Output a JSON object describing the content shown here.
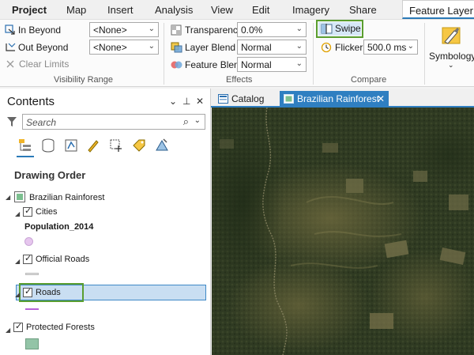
{
  "ribbon_tabs": [
    "Project",
    "Map",
    "Insert",
    "Analysis",
    "View",
    "Edit",
    "Imagery",
    "Share",
    "Feature Layer"
  ],
  "visibility_range": {
    "in_beyond_label": "In Beyond",
    "in_beyond_value": "<None>",
    "out_beyond_label": "Out Beyond",
    "out_beyond_value": "<None>",
    "clear_limits_label": "Clear Limits",
    "group_label": "Visibility Range"
  },
  "effects": {
    "transparency_label": "Transparency",
    "transparency_value": "0.0%",
    "layer_blend_label": "Layer Blend",
    "layer_blend_value": "Normal",
    "feature_blend_label": "Feature Blend",
    "feature_blend_value": "Normal",
    "group_label": "Effects"
  },
  "compare": {
    "swipe_label": "Swipe",
    "flicker_label": "Flicker",
    "flicker_value": "500.0",
    "flicker_unit": "ms",
    "group_label": "Compare"
  },
  "symbology": {
    "label": "Symbology"
  },
  "contents": {
    "title": "Contents",
    "search_placeholder": "Search",
    "drawing_order": "Drawing Order",
    "map_name": "Brazilian Rainforest",
    "layers": [
      {
        "name": "Cities",
        "legend_label": "Population_2014",
        "symbol_color": "#e6c6ee"
      },
      {
        "name": "Official Roads",
        "symbol_color": "#d9d9d9"
      },
      {
        "name": "Roads",
        "symbol_color": "#b763d8"
      },
      {
        "name": "Protected Forests",
        "symbol_color": "#93c4a7"
      }
    ]
  },
  "doc_tabs": {
    "catalog": "Catalog",
    "map_tab": "Brazilian Rainforest"
  },
  "colors": {
    "accent": "#2f7fc1",
    "highlight": "#5a9e2f",
    "selection": "#c9def2"
  }
}
